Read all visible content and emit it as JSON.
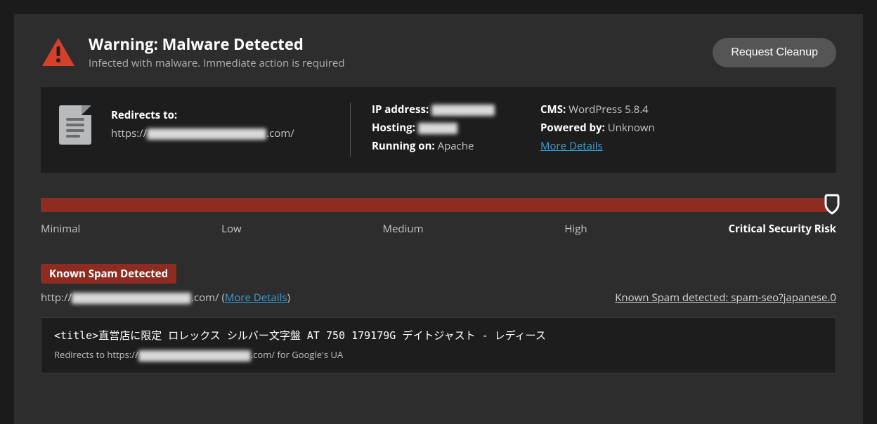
{
  "header": {
    "title": "Warning: Malware Detected",
    "subtitle": "Infected with malware. Immediate action is required",
    "cleanup_label": "Request Cleanup"
  },
  "info": {
    "redirect_label": "Redirects to:",
    "redirect_prefix": "https://",
    "redirect_suffix": ".com/",
    "ip_label": "IP address:",
    "hosting_label": "Hosting:",
    "running_label": "Running on:",
    "running_value": "Apache",
    "cms_label": "CMS:",
    "cms_value": "WordPress 5.8.4",
    "powered_label": "Powered by:",
    "powered_value": "Unknown",
    "more_details": "More Details"
  },
  "risk": {
    "levels": [
      "Minimal",
      "Low",
      "Medium",
      "High",
      "Critical Security Risk"
    ]
  },
  "spam": {
    "badge": "Known Spam Detected",
    "url_prefix": "http://",
    "url_suffix": ".com/",
    "more_details": "More Details",
    "detected_text": "Known Spam detected: spam-seo?japanese.0",
    "code_title": "<title>直営店に限定  ロレックス  シルバー文字盤  AT  750  179179G  デイトジャスト  -  レディース",
    "redir_prefix": "Redirects to https://",
    "redir_suffix": ".com/ for Google's UA"
  }
}
